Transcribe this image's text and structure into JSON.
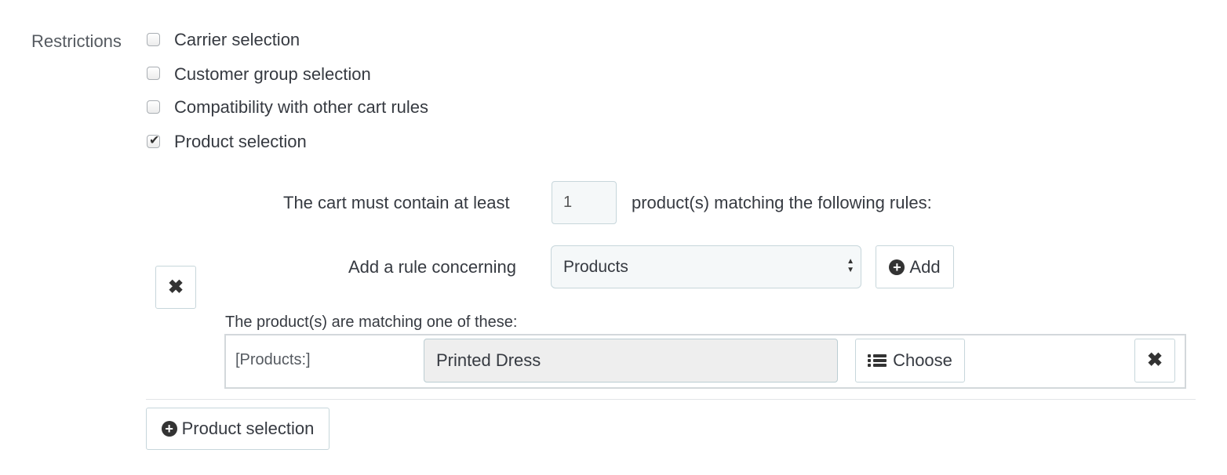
{
  "restrictions": {
    "label": "Restrictions",
    "options": [
      {
        "label": "Carrier selection",
        "checked": false
      },
      {
        "label": "Customer group selection",
        "checked": false
      },
      {
        "label": "Compatibility with other cart rules",
        "checked": false
      },
      {
        "label": "Product selection",
        "checked": true
      }
    ]
  },
  "product_rule": {
    "cart_min_prefix": "The cart must contain at least",
    "cart_min_value": "1",
    "cart_min_suffix": "product(s) matching the following rules:",
    "add_rule_label": "Add a rule concerning",
    "rule_type_selected": "Products",
    "add_button": "Add",
    "matching_label": "The product(s) are matching one of these:",
    "rule_row": {
      "type_label": "[Products:]",
      "value": "Printed Dress",
      "choose_button": "Choose"
    },
    "product_selection_button": "Product selection"
  },
  "icons": {
    "remove_group": "close-icon",
    "remove_rule": "close-icon",
    "add": "plus-circle-icon",
    "choose": "list-icon"
  }
}
